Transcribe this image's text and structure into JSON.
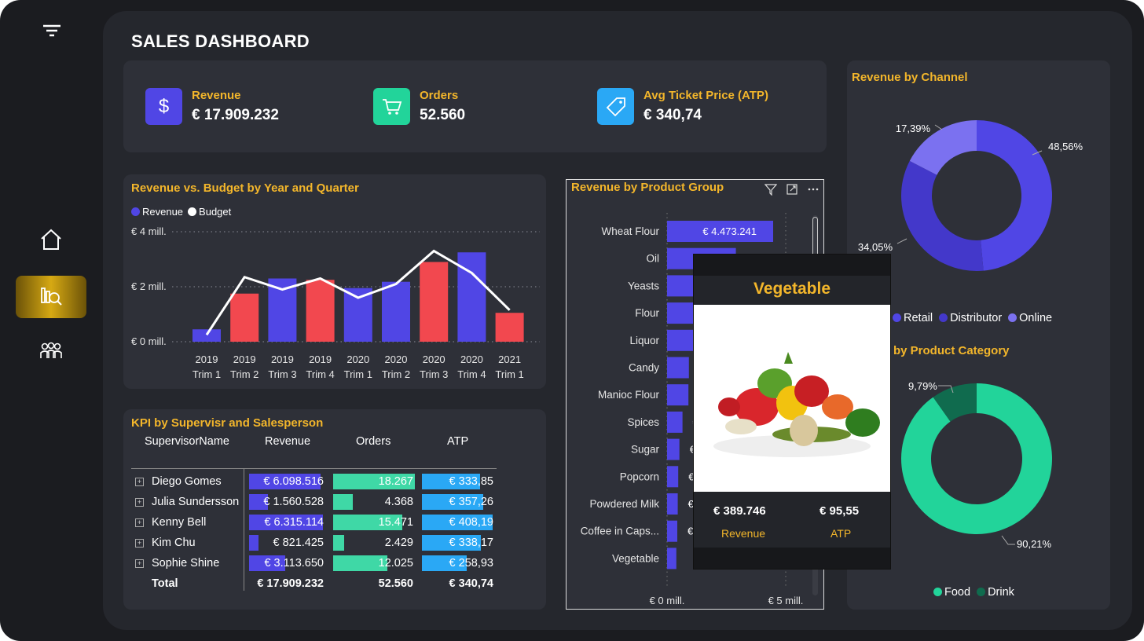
{
  "title": "SALES DASHBOARD",
  "colors": {
    "accent": "#f3b62b",
    "revenue": "#5046e5",
    "budget": "#ffffff",
    "red": "#f2484f",
    "orders": "#3fd8a6",
    "atp": "#2aa8f5",
    "online": "#7b71f0",
    "distributor": "#4338ca",
    "food": "#22d49a",
    "drink": "#106b4e"
  },
  "nav": {
    "items": [
      "filter-icon",
      "home-icon",
      "analytics-icon",
      "team-icon"
    ]
  },
  "kpis": [
    {
      "label": "Revenue",
      "value": "€ 17.909.232",
      "icon": "dollar-icon"
    },
    {
      "label": "Orders",
      "value": "52.560",
      "icon": "cart-icon"
    },
    {
      "label": "Avg Ticket Price (ATP)",
      "value": "€ 340,74",
      "icon": "tag-icon"
    }
  ],
  "revenue_budget": {
    "title": "Revenue vs. Budget by Year and Quarter",
    "legend": [
      "Revenue",
      "Budget"
    ],
    "yticks": [
      "€ 4 mill.",
      "€ 2 mill.",
      "€ 0 mill."
    ],
    "years": [
      "2019",
      "2019",
      "2019",
      "2019",
      "2020",
      "2020",
      "2020",
      "2020",
      "2021"
    ],
    "quarters": [
      "Trim 1",
      "Trim 2",
      "Trim 3",
      "Trim 4",
      "Trim 1",
      "Trim 2",
      "Trim 3",
      "Trim 4",
      "Trim 1"
    ]
  },
  "kpi_table": {
    "title": "KPI by Supervisr and Salesperson",
    "headers": [
      "SupervisorName",
      "Revenue",
      "Orders",
      "ATP"
    ],
    "rows": [
      {
        "name": "Diego Gomes",
        "revenue": "€ 6.098.516",
        "orders": "18.267",
        "atp": "€ 333,85",
        "rf": 0.97,
        "of": 1.0,
        "af": 0.82
      },
      {
        "name": "Julia Sundersson",
        "revenue": "€ 1.560.528",
        "orders": "4.368",
        "atp": "€ 357,26",
        "rf": 0.25,
        "of": 0.24,
        "af": 0.87
      },
      {
        "name": "Kenny Bell",
        "revenue": "€ 6.315.114",
        "orders": "15.471",
        "atp": "€ 408,19",
        "rf": 1.0,
        "of": 0.85,
        "af": 1.0
      },
      {
        "name": "Kim Chu",
        "revenue": "€ 821.425",
        "orders": "2.429",
        "atp": "€ 338,17",
        "rf": 0.13,
        "of": 0.13,
        "af": 0.83
      },
      {
        "name": "Sophie Shine",
        "revenue": "€ 3.113.650",
        "orders": "12.025",
        "atp": "€ 258,93",
        "rf": 0.49,
        "of": 0.66,
        "af": 0.63
      }
    ],
    "total": {
      "name": "Total",
      "revenue": "€ 17.909.232",
      "orders": "52.560",
      "atp": "€ 340,74"
    }
  },
  "product_group": {
    "title": "Revenue by Product Group",
    "first_value": "€ 4.473.241",
    "labels": [
      "Wheat Flour",
      "Oil",
      "Yeasts",
      "Flour",
      "Liquor",
      "Candy",
      "Manioc Flour",
      "Spices",
      "Sugar",
      "Popcorn",
      "Powdered Milk",
      "Coffee in Caps...",
      "Vegetable"
    ],
    "xticks": [
      "€ 0 mill.",
      "€ 5 mill."
    ],
    "partial_labels": [
      "€",
      "€",
      "€",
      "€",
      "€"
    ]
  },
  "tooltip": {
    "title": "Vegetable",
    "revenue": "€ 389.746",
    "atp": "€ 95,55",
    "revenue_label": "Revenue",
    "atp_label": "ATP"
  },
  "channel": {
    "title": "Revenue by Channel",
    "labels": [
      "48,56%",
      "34,05%",
      "17,39%"
    ],
    "legend": [
      "Retail",
      "Distributor",
      "Online"
    ]
  },
  "category": {
    "title": "by Product Category",
    "labels": [
      "90,21%",
      "9,79%"
    ],
    "legend": [
      "Food",
      "Drink"
    ]
  },
  "chart_data": [
    {
      "type": "bar",
      "title": "Revenue vs. Budget by Year and Quarter",
      "categories": [
        "2019 Trim 1",
        "2019 Trim 2",
        "2019 Trim 3",
        "2019 Trim 4",
        "2020 Trim 1",
        "2020 Trim 2",
        "2020 Trim 3",
        "2020 Trim 4",
        "2021 Trim 1"
      ],
      "series": [
        {
          "name": "Revenue",
          "values": [
            0.45,
            1.75,
            2.3,
            2.25,
            1.95,
            2.18,
            2.9,
            3.25,
            1.05
          ]
        },
        {
          "name": "Budget",
          "values": [
            0.25,
            2.35,
            1.9,
            2.3,
            1.6,
            2.1,
            3.3,
            2.5,
            1.15
          ]
        }
      ],
      "ylim": [
        0,
        4
      ],
      "ylabel": ""
    },
    {
      "type": "bar",
      "title": "Revenue by Product Group",
      "categories": [
        "Wheat Flour",
        "Oil",
        "Yeasts",
        "Flour",
        "Liquor",
        "Candy",
        "Manioc Flour",
        "Spices",
        "Sugar",
        "Popcorn",
        "Powdered Milk",
        "Coffee in Caps...",
        "Vegetable"
      ],
      "values": [
        4.47,
        2.9,
        2.4,
        2.2,
        1.1,
        0.92,
        0.9,
        0.65,
        0.52,
        0.47,
        0.45,
        0.43,
        0.39
      ],
      "xlim": [
        0,
        6.7
      ]
    },
    {
      "type": "pie",
      "title": "Revenue by Channel",
      "categories": [
        "Retail",
        "Distributor",
        "Online"
      ],
      "values": [
        48.56,
        34.05,
        17.39
      ]
    },
    {
      "type": "pie",
      "title": "by Product Category",
      "categories": [
        "Food",
        "Drink"
      ],
      "values": [
        90.21,
        9.79
      ]
    }
  ]
}
